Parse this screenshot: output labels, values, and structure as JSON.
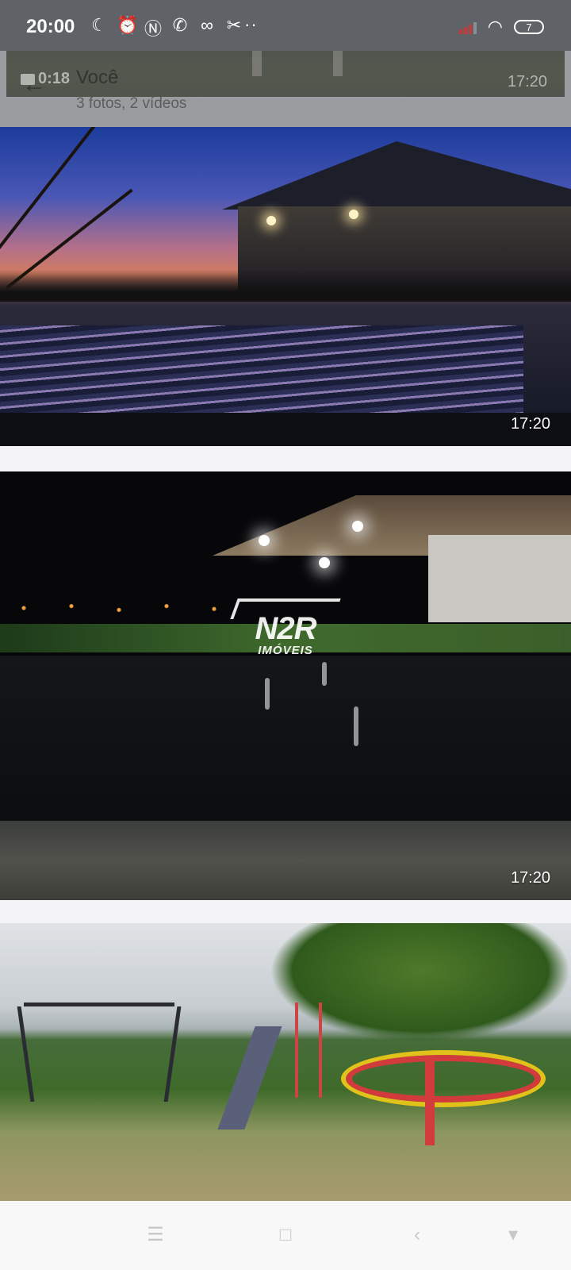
{
  "status_bar": {
    "time": "20:00",
    "icons": [
      "moon-icon",
      "alarm-icon",
      "nfc-icon",
      "whatsapp-icon",
      "voicemail-icon",
      "capcut-icon",
      "more-icon"
    ],
    "more_glyph": "··",
    "battery_level": "7"
  },
  "viewer_header": {
    "back_label": "←",
    "video_duration": "0:18",
    "title": "Você",
    "subtitle": "3 fotos, 2 vídeos",
    "peek_time": "17:20"
  },
  "media_items": [
    {
      "time": "17:20",
      "content": "sunset pool and gazebo photo"
    },
    {
      "time": "17:20",
      "content": "night pool photo"
    },
    {
      "time": "",
      "content": "playground photo"
    }
  ],
  "watermark": {
    "logo": "N2R",
    "sub": "IMÓVEIS"
  },
  "nav_bar": {
    "items": [
      "menu-icon",
      "home-icon",
      "back-icon",
      "assistant-icon"
    ],
    "glyphs": [
      "☰",
      "□",
      "‹",
      "▾"
    ]
  },
  "colors": {
    "status_bar_bg": "#5f6368",
    "page_bg": "#f4f4f6",
    "nav_bar_bg": "#f8f8f8"
  }
}
